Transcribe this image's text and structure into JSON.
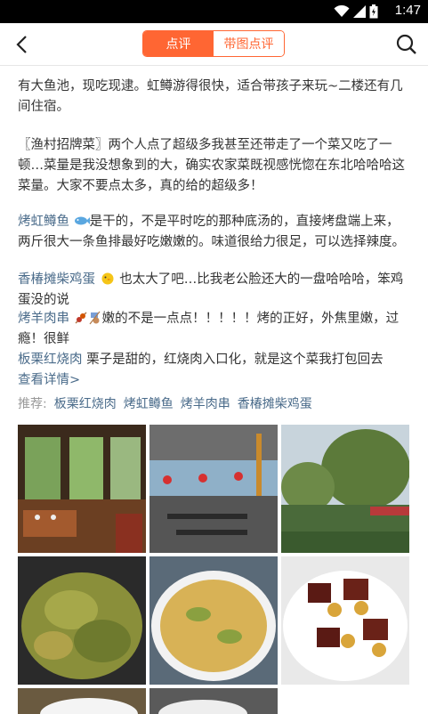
{
  "status": {
    "time": "1:47",
    "icons": [
      "wifi-icon",
      "signal-icon",
      "battery-icon"
    ]
  },
  "nav": {
    "tab_review": "点评",
    "tab_photo_review": "带图点评"
  },
  "review": {
    "p1": "有大鱼池，现吃现逮。虹鳟游得很快，适合带孩子来玩~二楼还有几间住宿。",
    "p2": "〖渔村招牌菜〗两个人点了超级多我甚至还带走了一个菜又吃了一顿…菜量是我没想象到的大，确实农家菜既视感恍惚在东北哈哈哈这菜量。大家不要点太多，真的给的超级多！",
    "dish1_name": "烤虹鳟鱼",
    "dish1_text": "是干的，不是平时吃的那种底汤的，直接烤盘端上来，两斤很大一条鱼排最好吃嫩嫩的。味道很给力很足，可以选择辣度。",
    "dish2_name": "香椿摊柴鸡蛋",
    "dish2_text": "也太大了吧…比我老公脸还大的一盘哈哈哈，笨鸡蛋没的说",
    "dish3_name": "烤羊肉串",
    "dish3_text": "嫩的不是一点点！！！！！烤的正好，外焦里嫩，过瘾！很鲜",
    "dish4_name": "板栗红烧肉",
    "dish4_text": "栗子是甜的，红烧肉入口化，就是这个菜我打包回去"
  },
  "more_label": "查看详情>",
  "recommend": {
    "label": "推荐:",
    "tags": [
      "板栗红烧肉",
      "烤虹鳟鱼",
      "烤羊肉串",
      "香椿摊柴鸡蛋"
    ]
  },
  "colors": {
    "accent": "#ff6633",
    "link": "#4a6b8a"
  }
}
